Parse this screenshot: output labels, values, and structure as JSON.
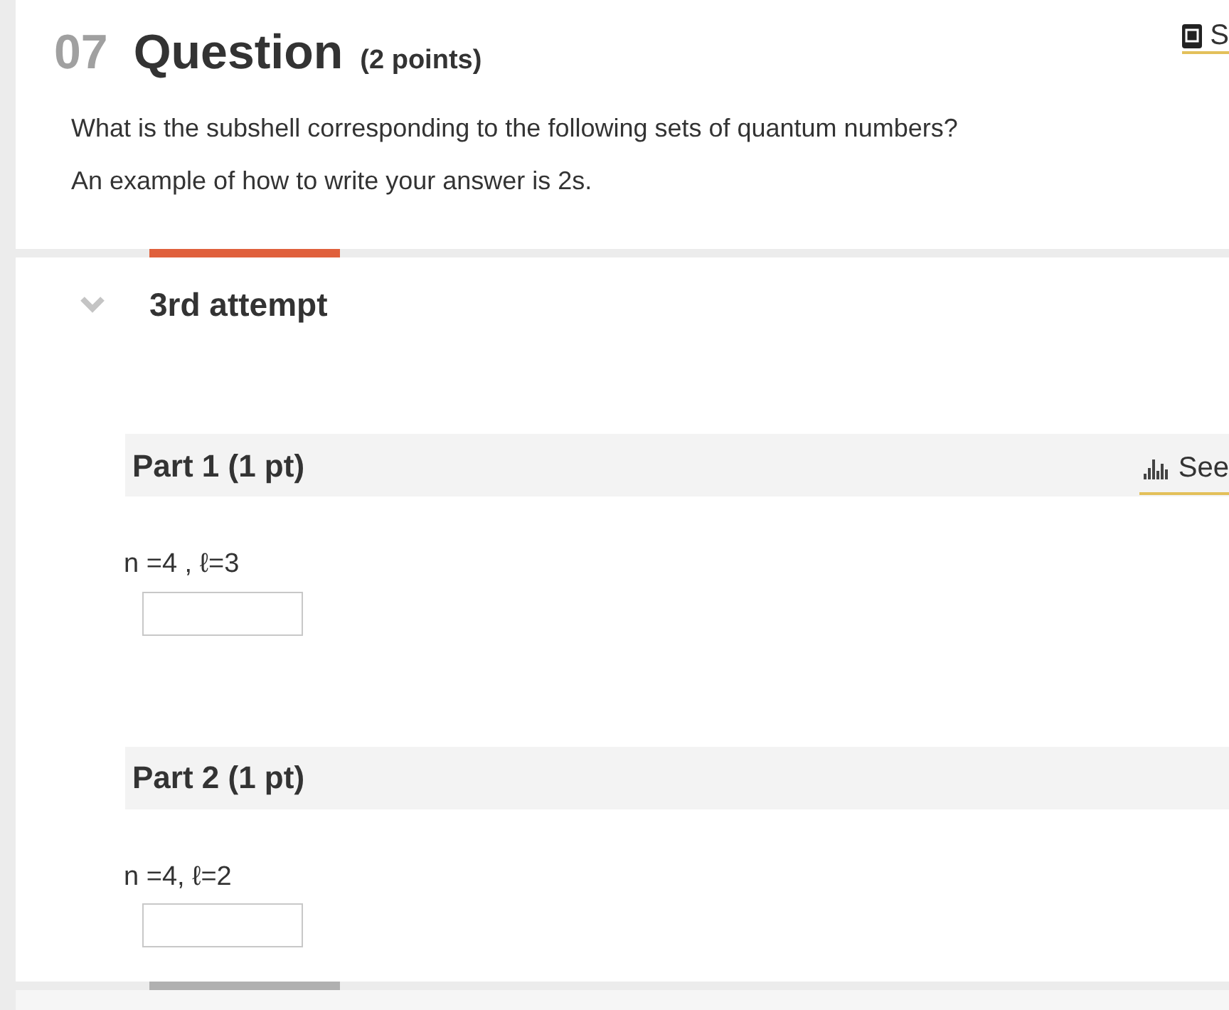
{
  "question": {
    "number": "07",
    "title": "Question",
    "points": "(2 points)",
    "ebook_link": "S",
    "prompt": [
      "What is the subshell corresponding to the following sets of quantum numbers?",
      "An example of how to write your answer is 2s."
    ]
  },
  "attempts": [
    {
      "label": "3rd attempt",
      "selected": true,
      "expanded": true,
      "parts": [
        {
          "title": "Part 1 (1 pt)",
          "see_link": "See",
          "prompt": "n =4 , ℓ=3"
        },
        {
          "title": "Part 2 (1 pt)",
          "prompt": "n =4, ℓ=2"
        }
      ]
    },
    {
      "selected": false
    }
  ]
}
